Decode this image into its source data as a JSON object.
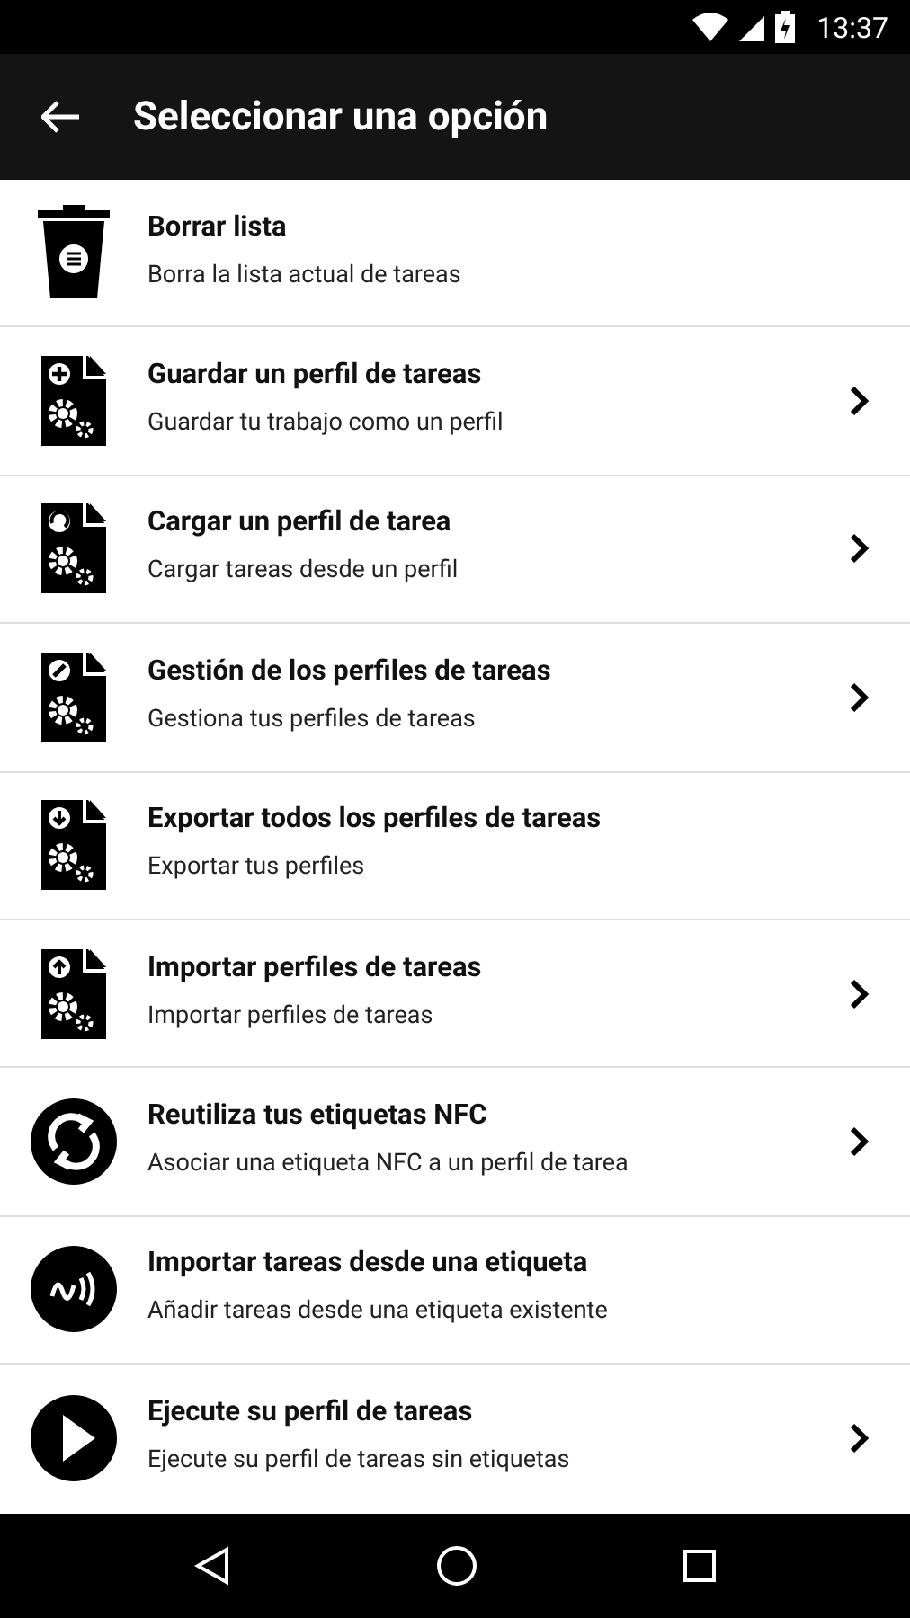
{
  "status_bar": {
    "time": "13:37"
  },
  "app_bar": {
    "title": "Seleccionar una opción"
  },
  "items": [
    {
      "kind": "trash",
      "title": "Borrar lista",
      "subtitle": "Borra la lista actual de tareas",
      "chevron": false
    },
    {
      "kind": "docplus",
      "title": "Guardar un perfil de tareas",
      "subtitle": "Guardar tu trabajo como un perfil",
      "chevron": true
    },
    {
      "kind": "docundo",
      "title": "Cargar un perfil de tarea",
      "subtitle": "Cargar tareas desde un perfil",
      "chevron": true
    },
    {
      "kind": "docedit",
      "title": "Gestión de los perfiles de tareas",
      "subtitle": "Gestiona tus perfiles de tareas",
      "chevron": true
    },
    {
      "kind": "docdown",
      "title": "Exportar todos los perfiles de tareas",
      "subtitle": "Exportar tus perfiles",
      "chevron": false
    },
    {
      "kind": "docup",
      "title": "Importar perfiles de tareas",
      "subtitle": "Importar perfiles de tareas",
      "chevron": true
    },
    {
      "kind": "sync",
      "title": "Reutiliza tus etiquetas NFC",
      "subtitle": "Asociar una etiqueta NFC a un perfil de tarea",
      "chevron": true
    },
    {
      "kind": "nfc",
      "title": "Importar tareas desde una etiqueta",
      "subtitle": "Añadir tareas desde una etiqueta existente",
      "chevron": false
    },
    {
      "kind": "play",
      "title": "Ejecute su perfil de tareas",
      "subtitle": "Ejecute su perfil de tareas sin etiquetas",
      "chevron": true
    }
  ]
}
